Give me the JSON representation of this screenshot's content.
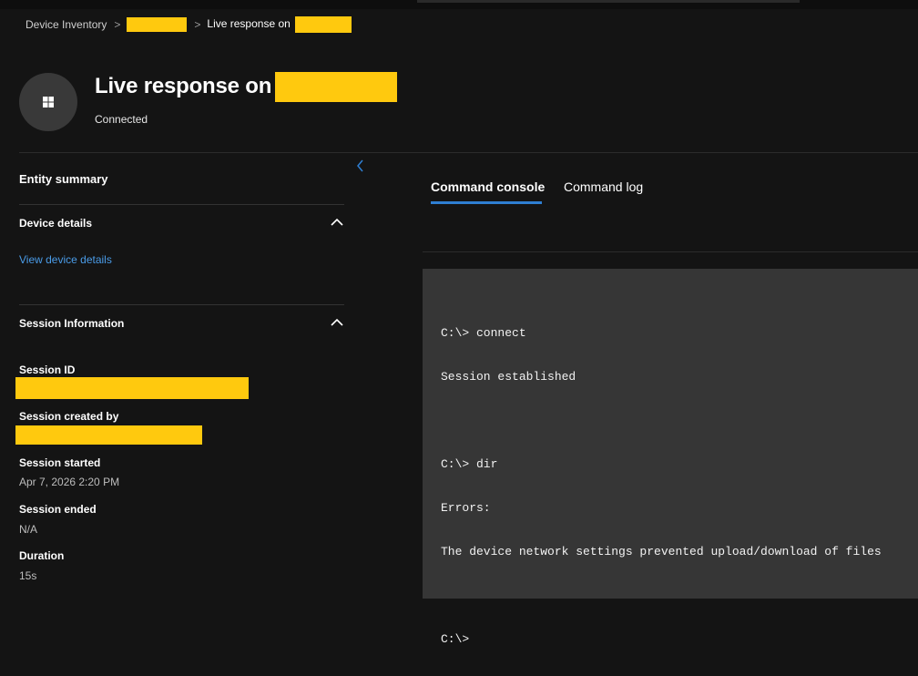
{
  "breadcrumb": {
    "root": "Device Inventory",
    "current_prefix": "Live response on"
  },
  "header": {
    "title": "Live response on",
    "status": "Connected",
    "device_icon": "windows-logo-icon"
  },
  "sidebar": {
    "title": "Entity summary",
    "collapse_icon": "chevron-left-icon",
    "device_details": {
      "heading": "Device details",
      "link": "View device details",
      "toggle_icon": "chevron-up-icon"
    },
    "session_info": {
      "heading": "Session Information",
      "toggle_icon": "chevron-up-icon",
      "fields": [
        {
          "label": "Session ID",
          "value": ""
        },
        {
          "label": "Session created by",
          "value": ""
        },
        {
          "label": "Session started",
          "value": "Apr 7, 2026 2:20 PM"
        },
        {
          "label": "Session ended",
          "value": "N/A"
        },
        {
          "label": "Duration",
          "value": "15s"
        }
      ]
    }
  },
  "tabs": [
    {
      "label": "Command console",
      "active": true
    },
    {
      "label": "Command log",
      "active": false
    }
  ],
  "console": {
    "lines": [
      "C:\\> connect",
      "Session established",
      "",
      "C:\\> dir",
      "Errors:",
      "The device network settings prevented upload/download of files",
      "",
      "C:\\>"
    ]
  },
  "colors": {
    "accent": "#2f7fd3",
    "link": "#4a9ce8",
    "redaction": "#ffc90e",
    "console_bg": "#363636",
    "page_bg": "#141414"
  }
}
